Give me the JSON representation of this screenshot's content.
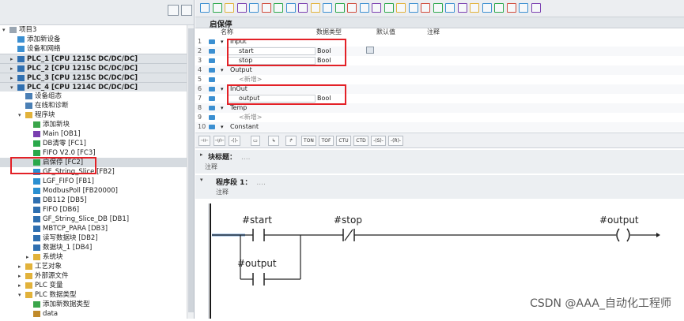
{
  "left_panel": {
    "tree": [
      {
        "label": "项目3",
        "indent": 0,
        "toggle": "▾",
        "icon": "project-icon",
        "kind": "normal"
      },
      {
        "label": "添加新设备",
        "indent": 1,
        "toggle": "",
        "icon": "add-device-icon",
        "kind": "normal"
      },
      {
        "label": "设备和网络",
        "indent": 1,
        "toggle": "",
        "icon": "network-icon",
        "kind": "normal"
      },
      {
        "label": "PLC_1 [CPU 1215C DC/DC/DC]",
        "indent": 1,
        "toggle": "▸",
        "icon": "plc-icon",
        "kind": "plc"
      },
      {
        "label": "PLC_2 [CPU 1215C DC/DC/DC]",
        "indent": 1,
        "toggle": "▸",
        "icon": "plc-icon",
        "kind": "plc"
      },
      {
        "label": "PLC_3 [CPU 1215C DC/DC/DC]",
        "indent": 1,
        "toggle": "▸",
        "icon": "plc-icon",
        "kind": "plc"
      },
      {
        "label": "PLC_4 [CPU 1214C DC/DC/DC]",
        "indent": 1,
        "toggle": "▾",
        "icon": "plc-icon",
        "kind": "plc"
      },
      {
        "label": "设备组态",
        "indent": 2,
        "toggle": "",
        "icon": "device-config-icon",
        "kind": "normal"
      },
      {
        "label": "在线和诊断",
        "indent": 2,
        "toggle": "",
        "icon": "diagnostics-icon",
        "kind": "normal"
      },
      {
        "label": "程序块",
        "indent": 2,
        "toggle": "▾",
        "icon": "folder-icon",
        "kind": "normal"
      },
      {
        "label": "添加新块",
        "indent": 3,
        "toggle": "",
        "icon": "add-block-icon",
        "kind": "normal"
      },
      {
        "label": "Main [OB1]",
        "indent": 3,
        "toggle": "",
        "icon": "ob-block-icon",
        "kind": "normal"
      },
      {
        "label": "DB清零 [FC1]",
        "indent": 3,
        "toggle": "",
        "icon": "fc-block-icon",
        "kind": "normal"
      },
      {
        "label": "FIFO V2.0 [FC3]",
        "indent": 3,
        "toggle": "",
        "icon": "fc-block-icon",
        "kind": "normal"
      },
      {
        "label": "启保停 [FC2]",
        "indent": 3,
        "toggle": "",
        "icon": "fc-block-icon",
        "kind": "sel"
      },
      {
        "label": "GF_String_Slice [FB2]",
        "indent": 3,
        "toggle": "",
        "icon": "fb-block-icon",
        "kind": "normal"
      },
      {
        "label": "LGF_FIFO [FB1]",
        "indent": 3,
        "toggle": "",
        "icon": "fb-block-icon",
        "kind": "normal"
      },
      {
        "label": "ModbusPoll [FB20000]",
        "indent": 3,
        "toggle": "",
        "icon": "fb-block-icon",
        "kind": "normal"
      },
      {
        "label": "DB112 [DB5]",
        "indent": 3,
        "toggle": "",
        "icon": "db-block-icon",
        "kind": "normal"
      },
      {
        "label": "FIFO [DB6]",
        "indent": 3,
        "toggle": "",
        "icon": "db-block-icon",
        "kind": "normal"
      },
      {
        "label": "GF_String_Slice_DB [DB1]",
        "indent": 3,
        "toggle": "",
        "icon": "db-block-icon",
        "kind": "normal"
      },
      {
        "label": "MBTCP_PARA [DB3]",
        "indent": 3,
        "toggle": "",
        "icon": "db-block-icon",
        "kind": "normal"
      },
      {
        "label": "读写数据块 [DB2]",
        "indent": 3,
        "toggle": "",
        "icon": "db-block-icon",
        "kind": "normal"
      },
      {
        "label": "数据块_1 [DB4]",
        "indent": 3,
        "toggle": "",
        "icon": "db-block-icon",
        "kind": "normal"
      },
      {
        "label": "系统块",
        "indent": 3,
        "toggle": "▸",
        "icon": "folder-icon",
        "kind": "normal"
      },
      {
        "label": "工艺对象",
        "indent": 2,
        "toggle": "▸",
        "icon": "folder-icon",
        "kind": "normal"
      },
      {
        "label": "外部源文件",
        "indent": 2,
        "toggle": "▸",
        "icon": "folder-icon",
        "kind": "normal"
      },
      {
        "label": "PLC 变量",
        "indent": 2,
        "toggle": "▸",
        "icon": "folder-icon",
        "kind": "normal"
      },
      {
        "label": "PLC 数据类型",
        "indent": 2,
        "toggle": "▾",
        "icon": "folder-icon",
        "kind": "normal"
      },
      {
        "label": "添加新数据类型",
        "indent": 3,
        "toggle": "",
        "icon": "add-type-icon",
        "kind": "normal"
      },
      {
        "label": "data",
        "indent": 3,
        "toggle": "",
        "icon": "type-icon",
        "kind": "normal"
      }
    ]
  },
  "editor": {
    "block_title": "启保停",
    "interface_headers": {
      "name": "名称",
      "datatype": "数据类型",
      "default": "默认值",
      "comment": "注释"
    },
    "interface_rows": [
      {
        "num": "1",
        "name": "Input",
        "type": "",
        "indent": 0,
        "toggle": "▾"
      },
      {
        "num": "2",
        "name": "start",
        "type": "Bool",
        "indent": 1,
        "toggle": ""
      },
      {
        "num": "3",
        "name": "stop",
        "type": "Bool",
        "indent": 1,
        "toggle": ""
      },
      {
        "num": "4",
        "name": "Output",
        "type": "",
        "indent": 0,
        "toggle": "▾"
      },
      {
        "num": "5",
        "name": "<新增>",
        "type": "",
        "indent": 1,
        "toggle": ""
      },
      {
        "num": "6",
        "name": "InOut",
        "type": "",
        "indent": 0,
        "toggle": "▾"
      },
      {
        "num": "7",
        "name": "output",
        "type": "Bool",
        "indent": 1,
        "toggle": ""
      },
      {
        "num": "8",
        "name": "Temp",
        "type": "",
        "indent": 0,
        "toggle": "▾"
      },
      {
        "num": "9",
        "name": "<新增>",
        "type": "",
        "indent": 1,
        "toggle": ""
      },
      {
        "num": "10",
        "name": "Constant",
        "type": "",
        "indent": 0,
        "toggle": "▾"
      }
    ],
    "ladder_buttons": [
      "TON",
      "TOF",
      "CTU",
      "CTD",
      "-(S)-",
      "-(R)-"
    ],
    "block_section": {
      "title": "块标题：",
      "title_extra": "....",
      "comment": "注释"
    },
    "network": {
      "title": "程序段 1：",
      "title_extra": "....",
      "comment": "注释"
    },
    "rung": {
      "contact_start": "#start",
      "contact_stop": "#stop",
      "coil_output": "#output",
      "contact_output": "#output"
    }
  },
  "watermark": "CSDN @AAA_自动化工程师",
  "colors": {
    "highlight": "#e32127",
    "accent": "#3b8fd1"
  }
}
